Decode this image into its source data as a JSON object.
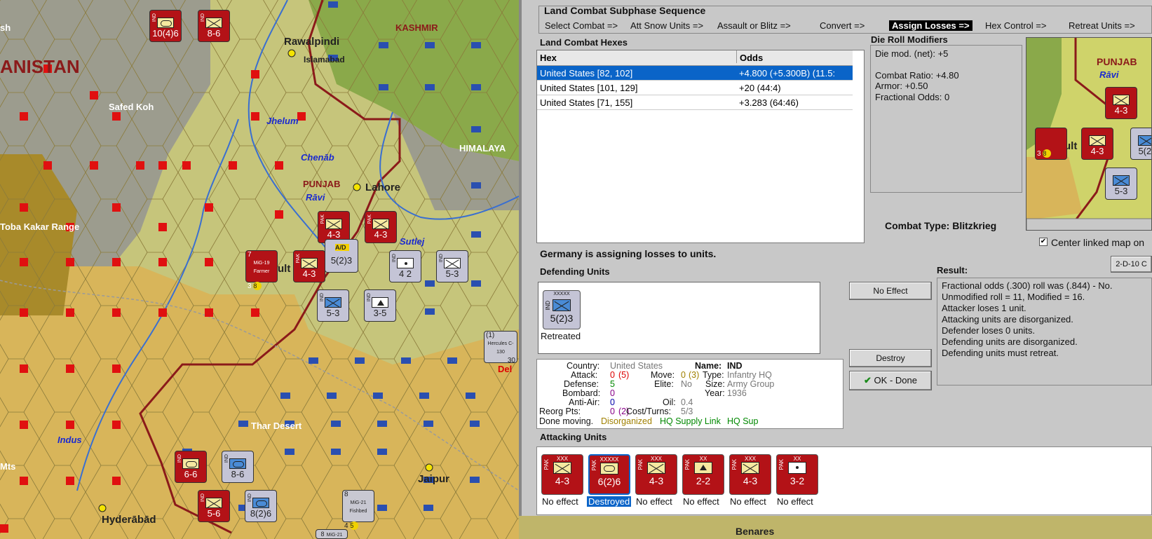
{
  "map": {
    "labels": {
      "afghanistan": "ANISTAN",
      "kashmir": "KASHMIR",
      "himalaya": "HIMALAYA",
      "punjab": "PUNJAB",
      "rawalpindi": "Rawalpindi",
      "islamabad": "Islamabad",
      "lahore": "Lahore",
      "jaipur": "Jaipur",
      "hyderabad": "Hyderābād",
      "benares": "Benares",
      "jhelum": "Jhelum",
      "chenab": "Chenāb",
      "ravi": "Rāvi",
      "sutlej": "Sutlej",
      "indus": "Indus",
      "safed_koh": "Safed Koh",
      "toba_kakar": "Toba Kakar Range",
      "thar": "Thar Desert",
      "sh": "sh",
      "mts": "Mts",
      "ult": "ult",
      "delhi_partial": "Del"
    },
    "units": [
      {
        "id": "u1",
        "nat": "IND",
        "top": "XXXXX",
        "str": "10(4)6",
        "type": "arm",
        "color": "red"
      },
      {
        "id": "u2",
        "nat": "IND",
        "top": "XX",
        "str": "8-6",
        "type": "inf",
        "color": "red"
      },
      {
        "id": "u3",
        "nat": "PAK",
        "top": "XXX",
        "str": "4-3",
        "type": "inf",
        "color": "red"
      },
      {
        "id": "u4",
        "nat": "PAK",
        "top": "XXX",
        "str": "4-3",
        "type": "inf",
        "color": "red"
      },
      {
        "id": "u5",
        "nat": "PAK",
        "top": "XXX",
        "str": "4-3",
        "type": "inf",
        "color": "red"
      },
      {
        "id": "u6",
        "nat": "IND",
        "top": "XX",
        "str": "4 2",
        "type": "dot",
        "color": "grey"
      },
      {
        "id": "u7",
        "nat": "IND",
        "top": "XX",
        "str": "5-3",
        "type": "inf",
        "color": "grey"
      },
      {
        "id": "u8",
        "nat": "IND",
        "top": "XXX",
        "str": "5-3",
        "type": "inf-blue",
        "color": "grey"
      },
      {
        "id": "u9",
        "nat": "IND",
        "top": "XX",
        "str": "3-5",
        "type": "mtn",
        "color": "grey"
      },
      {
        "id": "u10",
        "nat": "IND",
        "top": "XX",
        "str": "6-6",
        "type": "arm",
        "color": "red"
      },
      {
        "id": "u11",
        "nat": "IND",
        "top": "XXX",
        "str": "8-6",
        "type": "arm-blue",
        "color": "grey"
      },
      {
        "id": "u12",
        "nat": "IND",
        "top": "XX",
        "str": "5-6",
        "type": "inf",
        "color": "red"
      },
      {
        "id": "u13",
        "nat": "IND",
        "top": "XXXXX",
        "str": "8(2)6",
        "type": "arm-blue",
        "color": "grey"
      }
    ],
    "air": [
      {
        "id": "a1",
        "name": "MiG-19 Farmer",
        "top": "7",
        "left_num": "3",
        "badge": "8"
      },
      {
        "id": "a2",
        "name": "MiG-21 Fishbed",
        "top": "8",
        "left_num": "4",
        "badge": "5"
      },
      {
        "id": "a3",
        "name": "Hercules C-130",
        "top": "(1)",
        "badge": "30"
      },
      {
        "id": "a4",
        "name": "MiG-21",
        "top": "8"
      }
    ],
    "ad_unit": {
      "str": "5(2)3",
      "label": "A/D"
    }
  },
  "sequence": {
    "title": "Land Combat Subphase Sequence",
    "steps": [
      "Select Combat =>",
      "Att Snow Units =>",
      "Assault or Blitz =>",
      "Convert =>",
      "Assign Losses =>",
      "Hex Control =>",
      "Retreat Units =>"
    ],
    "active_index": 4
  },
  "hexes": {
    "title": "Land Combat Hexes",
    "col_hex": "Hex",
    "col_odds": "Odds",
    "rows": [
      {
        "hex": "United States [82, 102]",
        "odds": "+4.800 (+5.300B) (11.5:"
      },
      {
        "hex": "United States [101, 129]",
        "odds": "+20 (44:4)"
      },
      {
        "hex": "United States [71, 155]",
        "odds": "+3.283 (64:46)"
      }
    ],
    "selected_index": 0
  },
  "modifiers": {
    "title": "Die Roll Modifiers",
    "lines": [
      "Die mod. (net): +5",
      "",
      "Combat Ratio: +4.80",
      "Armor: +0.50",
      "Fractional Odds: 0"
    ]
  },
  "minimap": {
    "punjab": "PUNJAB",
    "ravi": "Rāvi",
    "ult": "ult",
    "units": [
      "4-3",
      "4-3",
      "5(2)",
      "5-3"
    ],
    "air_badge": "8",
    "air_left": "3"
  },
  "combat_type": {
    "label": "Combat Type:",
    "value": "Blitzkrieg"
  },
  "center_linked": {
    "checked": "✔",
    "label": "Center linked map on"
  },
  "btn_2d10": "2-D-10 C",
  "message": "Germany is assigning losses to units.",
  "defending": {
    "title": "Defending Units",
    "units": [
      {
        "nat": "IND",
        "size": "XXXXX",
        "str": "5(2)3",
        "status": "Retreated"
      }
    ]
  },
  "buttons": {
    "no_effect": "No Effect",
    "destroy": "Destroy",
    "ok_done": "OK - Done"
  },
  "result": {
    "title": "Result:",
    "lines": [
      "Fractional odds (.300) roll was (.844)  - No.",
      "Unmodified roll = 11, Modified = 16.",
      "Attacker loses 1 unit.",
      "Attacking units are disorganized.",
      "Defender loses 0 units.",
      "Defending units are disorganized.",
      "Defending units must retreat."
    ]
  },
  "unit_info": {
    "country_label": "Country:",
    "country": "United States",
    "attack_label": "Attack:",
    "attack": "0",
    "attack_paren": "(5)",
    "defense_label": "Defense:",
    "defense": "5",
    "bombard_label": "Bombard:",
    "bombard": "0",
    "antiair_label": "Anti-Air:",
    "antiair": "0",
    "reorg_label": "Reorg Pts:",
    "reorg": "0",
    "reorg_paren": "(2)",
    "move_label": "Move:",
    "move": "0",
    "move_paren": "(3)",
    "elite_label": "Elite:",
    "elite": "No",
    "oil_label": "Oil:",
    "oil": "0.4",
    "cost_label": "Cost/Turns:",
    "cost": "5/3",
    "name_label": "Name:",
    "name": "IND",
    "type_label": "Type:",
    "type": "Infantry HQ",
    "size_label": "Size:",
    "size": "Army Group",
    "year_label": "Year:",
    "year": "1936",
    "done": "Done moving.",
    "disorg": "Disorganized",
    "hq_supply": "HQ Supply Link",
    "hq_sup": "HQ Sup"
  },
  "attacking": {
    "title": "Attacking Units",
    "units": [
      {
        "nat": "PAK",
        "size": "XXX",
        "str": "4-3",
        "sym": "inf",
        "status": "No effect"
      },
      {
        "nat": "PAK",
        "size": "XXXXX",
        "str": "6(2)6",
        "sym": "arm",
        "status": "Destroyed"
      },
      {
        "nat": "PAK",
        "size": "XXX",
        "str": "4-3",
        "sym": "inf",
        "status": "No effect"
      },
      {
        "nat": "PAK",
        "size": "XX",
        "str": "2-2",
        "sym": "mtn",
        "status": "No effect"
      },
      {
        "nat": "PAK",
        "size": "XXX",
        "str": "4-3",
        "sym": "inf",
        "status": "No effect"
      },
      {
        "nat": "PAK",
        "size": "XX",
        "str": "3-2",
        "sym": "dot",
        "status": "No effect"
      }
    ],
    "selected_index": 1
  },
  "bottom_map": {
    "benares": "Benares"
  }
}
